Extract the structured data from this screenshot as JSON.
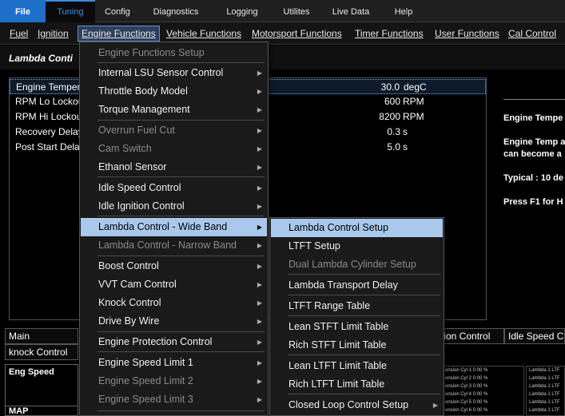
{
  "menubar": [
    "File",
    "Tuning",
    "Config",
    "Diagnostics",
    "Logging",
    "Utilites",
    "Live Data",
    "Help"
  ],
  "submenu": {
    "fuel": "Fuel",
    "ignition": "Ignition",
    "engine_functions": "Engine Functions",
    "vehicle_functions": "Vehicle Functions",
    "motorsport_functions": "Motorsport Functions",
    "timer_functions": "Timer Functions",
    "user_functions": "User Functions",
    "cal_control": "Cal Control"
  },
  "page_title": "Lambda Conti",
  "params": [
    {
      "name": "Engine Temper",
      "value": "30.0",
      "unit": "degC"
    },
    {
      "name": "RPM Lo Lockou",
      "value": "600",
      "unit": "RPM"
    },
    {
      "name": "RPM Hi Lockou",
      "value": "8200",
      "unit": "RPM"
    },
    {
      "name": "Recovery Delay",
      "value": "0.3",
      "unit": "s"
    },
    {
      "name": "Post Start Dela",
      "value": "5.0",
      "unit": "s"
    }
  ],
  "help": {
    "line1": "Engine Tempe",
    "line2a": "Engine Temp a",
    "line2b": "can become a",
    "line3": "Typical : 10 de",
    "line4": "Press F1 for H"
  },
  "tabs": {
    "main": "Main",
    "knock": "knock Control",
    "tion_control": "tion Control",
    "idle_speed": "Idle Speed C"
  },
  "gauges": {
    "eng_speed": "Eng Speed",
    "map": "MAP"
  },
  "tables": {
    "left_rows": [
      "ension Cyl 1  0.00 %",
      "ension Cyl 2  0.00 %",
      "ension Cyl 3  0.00 %",
      "ension Cyl 4  0.00 %",
      "ension Cyl 5  0.00 %",
      "ension Cyl 6  0.00 %"
    ],
    "right_rows": [
      "Lambda 1 LTF",
      "Lambda 1 LTF",
      "Lambda 1 LTF",
      "Lambda 1 LTF",
      "Lambda 1 LTF",
      "Lambda 1 LTF"
    ]
  },
  "engine_menu": {
    "items": [
      {
        "label": "Engine Functions Setup",
        "disabled": true
      },
      {
        "label": "Internal LSU Sensor Control",
        "arrow": true
      },
      {
        "label": "Throttle Body Model",
        "arrow": true
      },
      {
        "label": "Torque Management",
        "arrow": true
      },
      {
        "label": "Overrun Fuel Cut",
        "disabled": true,
        "arrow": true
      },
      {
        "label": "Cam Switch",
        "disabled": true,
        "arrow": true
      },
      {
        "label": "Ethanol Sensor",
        "arrow": true
      },
      {
        "label": "Idle Speed Control",
        "arrow": true
      },
      {
        "label": "Idle Ignition Control",
        "arrow": true
      },
      {
        "label": "Lambda Control - Wide Band",
        "arrow": true,
        "highlight": true
      },
      {
        "label": "Lambda Control - Narrow Band",
        "disabled": true,
        "arrow": true
      },
      {
        "label": "Boost Control",
        "arrow": true
      },
      {
        "label": "VVT Cam Control",
        "arrow": true
      },
      {
        "label": "Knock Control",
        "arrow": true
      },
      {
        "label": "Drive By Wire",
        "arrow": true
      },
      {
        "label": "Engine Protection Control",
        "arrow": true
      },
      {
        "label": "Engine Speed Limit 1",
        "arrow": true
      },
      {
        "label": "Engine Speed Limit 2",
        "disabled": true,
        "arrow": true
      },
      {
        "label": "Engine Speed Limit 3",
        "disabled": true,
        "arrow": true
      }
    ]
  },
  "lambda_menu": {
    "items": [
      {
        "label": "Lambda Control Setup",
        "highlight": true
      },
      {
        "label": "LTFT Setup"
      },
      {
        "label": "Dual Lambda Cylinder Setup",
        "disabled": true
      },
      {
        "label": "Lambda Transport Delay"
      },
      {
        "label": "LTFT Range Table"
      },
      {
        "label": "Lean STFT Limit Table"
      },
      {
        "label": "Rich STFT Limit Table"
      },
      {
        "label": "Lean LTFT Limit Table"
      },
      {
        "label": "Rich LTFT Limit Table"
      },
      {
        "label": "Closed Loop Control Setup",
        "arrow": true
      }
    ]
  },
  "arrow_glyph": "▶"
}
